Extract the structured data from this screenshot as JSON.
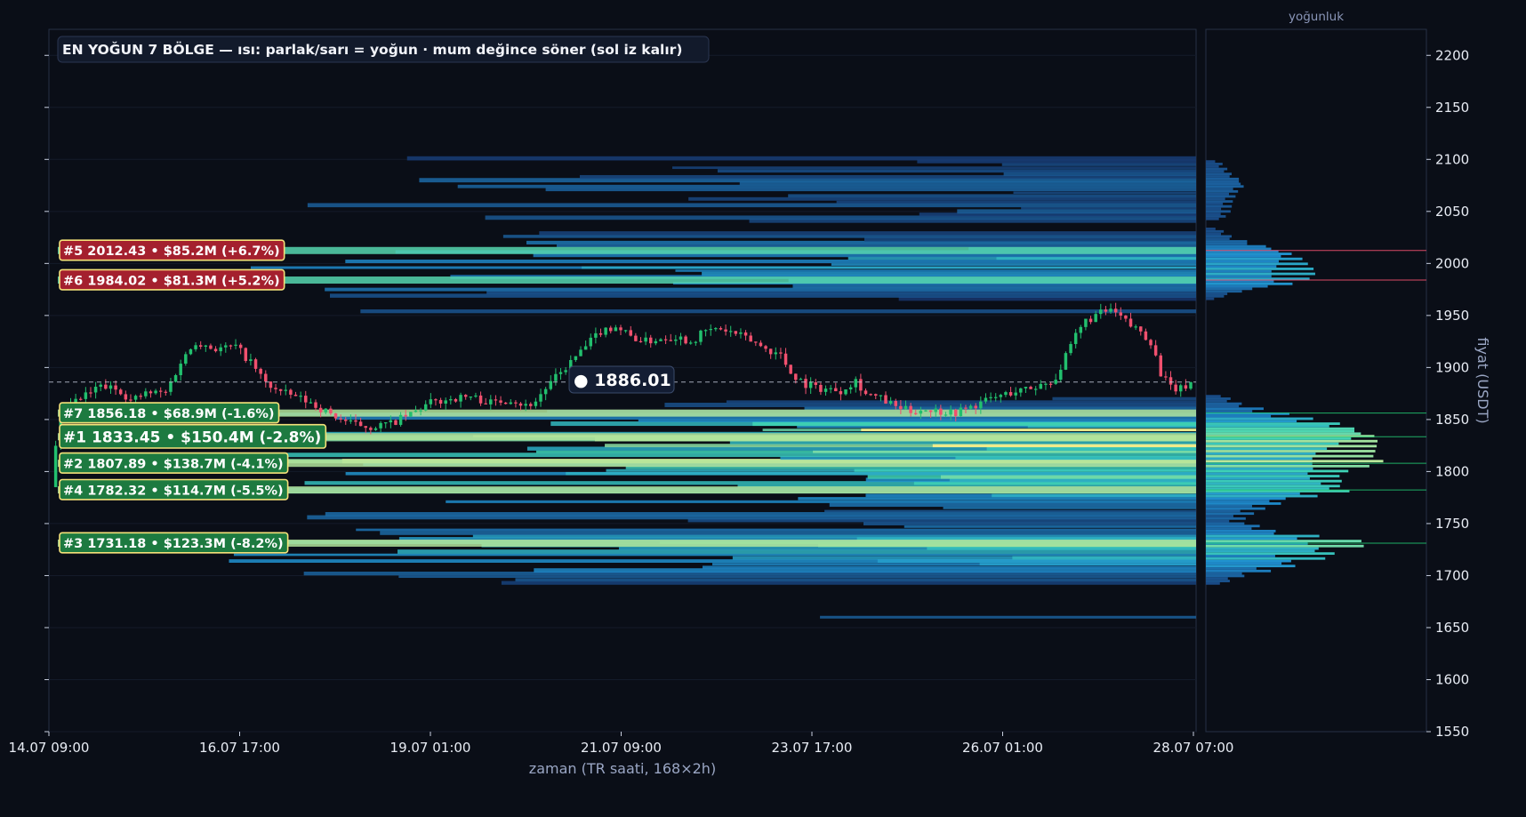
{
  "colors": {
    "background": "#0a0e17",
    "panel_border": "#263046",
    "bull": "#22c06e",
    "bear": "#f0506e",
    "heat_low": "#17326a",
    "heat_mid": "#1f8fd0",
    "heat_high": "#3fd3b4",
    "heat_peak": "#fdf08a",
    "label_bear_bg": "#a4202e",
    "label_bull_bg": "#1d7a40",
    "label_border": "#f5e27a",
    "text": "#e8ecf4",
    "muted": "#9aa6c4"
  },
  "title": "EN YOĞUN 7 BÖLGE — ısı: parlak/sarı = yoğun · mum değince söner (sol iz kalır)",
  "chart_data": {
    "type": "candlestick",
    "xlabel": "zaman (TR saati, 168×2h)",
    "ylabel": "fiyat (USDT)",
    "ylim": [
      1550,
      2225
    ],
    "x_ticks": [
      "14.07 09:00",
      "16.07 17:00",
      "19.07 01:00",
      "21.07 09:00",
      "23.07 17:00",
      "26.07 01:00",
      "28.07 07:00"
    ],
    "y_ticks": [
      1550,
      1600,
      1650,
      1700,
      1750,
      1800,
      1850,
      1900,
      1950,
      2000,
      2050,
      2100,
      2150,
      2200
    ],
    "current_price": 1886.01,
    "current_price_label": "● 1886.01",
    "close_path": [
      [
        0,
        1785
      ],
      [
        2,
        1858
      ],
      [
        6,
        1870
      ],
      [
        10,
        1882
      ],
      [
        14,
        1878
      ],
      [
        16,
        1868
      ],
      [
        19,
        1875
      ],
      [
        23,
        1876
      ],
      [
        26,
        1905
      ],
      [
        29,
        1925
      ],
      [
        33,
        1918
      ],
      [
        37,
        1920
      ],
      [
        40,
        1905
      ],
      [
        43,
        1885
      ],
      [
        46,
        1876
      ],
      [
        49,
        1872
      ],
      [
        52,
        1866
      ],
      [
        56,
        1855
      ],
      [
        60,
        1846
      ],
      [
        64,
        1843
      ],
      [
        68,
        1846
      ],
      [
        72,
        1855
      ],
      [
        76,
        1866
      ],
      [
        80,
        1870
      ],
      [
        84,
        1872
      ],
      [
        88,
        1866
      ],
      [
        92,
        1870
      ],
      [
        95,
        1863
      ],
      [
        97,
        1868
      ],
      [
        99,
        1880
      ],
      [
        102,
        1895
      ],
      [
        104,
        1905
      ],
      [
        107,
        1920
      ],
      [
        110,
        1935
      ],
      [
        113,
        1940
      ],
      [
        116,
        1930
      ],
      [
        119,
        1925
      ],
      [
        122,
        1928
      ],
      [
        125,
        1930
      ],
      [
        128,
        1925
      ],
      [
        131,
        1935
      ],
      [
        134,
        1937
      ],
      [
        137,
        1932
      ],
      [
        140,
        1926
      ],
      [
        143,
        1918
      ],
      [
        146,
        1912
      ],
      [
        148,
        1895
      ],
      [
        151,
        1884
      ],
      [
        154,
        1880
      ],
      [
        158,
        1878
      ],
      [
        161,
        1888
      ],
      [
        163,
        1875
      ],
      [
        166,
        1870
      ],
      [
        169,
        1862
      ],
      [
        172,
        1858
      ],
      [
        175,
        1860
      ],
      [
        178,
        1858
      ],
      [
        181,
        1857
      ],
      [
        184,
        1862
      ],
      [
        188,
        1870
      ],
      [
        192,
        1876
      ],
      [
        196,
        1880
      ],
      [
        199,
        1885
      ],
      [
        201,
        1890
      ],
      [
        203,
        1910
      ],
      [
        205,
        1930
      ],
      [
        207,
        1945
      ],
      [
        210,
        1952
      ],
      [
        212,
        1955
      ],
      [
        214,
        1948
      ],
      [
        216,
        1940
      ],
      [
        218,
        1935
      ],
      [
        220,
        1925
      ],
      [
        222,
        1895
      ],
      [
        224,
        1880
      ],
      [
        226,
        1879
      ],
      [
        228,
        1886
      ]
    ],
    "density_profile": [
      [
        1695,
        0.12
      ],
      [
        1700,
        0.2
      ],
      [
        1705,
        0.35
      ],
      [
        1710,
        0.5
      ],
      [
        1716,
        0.62
      ],
      [
        1722,
        0.72
      ],
      [
        1728,
        0.82
      ],
      [
        1733,
        0.78
      ],
      [
        1738,
        0.55
      ],
      [
        1743,
        0.35
      ],
      [
        1748,
        0.28
      ],
      [
        1755,
        0.2
      ],
      [
        1760,
        0.25
      ],
      [
        1765,
        0.32
      ],
      [
        1770,
        0.42
      ],
      [
        1776,
        0.58
      ],
      [
        1781,
        0.72
      ],
      [
        1785,
        0.78
      ],
      [
        1790,
        0.76
      ],
      [
        1795,
        0.72
      ],
      [
        1800,
        0.74
      ],
      [
        1805,
        0.82
      ],
      [
        1810,
        0.86
      ],
      [
        1815,
        0.84
      ],
      [
        1820,
        0.88
      ],
      [
        1825,
        0.92
      ],
      [
        1830,
        0.96
      ],
      [
        1835,
        0.98
      ],
      [
        1840,
        0.9
      ],
      [
        1845,
        0.78
      ],
      [
        1850,
        0.6
      ],
      [
        1855,
        0.45
      ],
      [
        1860,
        0.3
      ],
      [
        1865,
        0.18
      ],
      [
        1870,
        0.12
      ],
      [
        1970,
        0.12
      ],
      [
        1975,
        0.25
      ],
      [
        1980,
        0.45
      ],
      [
        1985,
        0.52
      ],
      [
        1990,
        0.53
      ],
      [
        1995,
        0.54
      ],
      [
        2000,
        0.53
      ],
      [
        2005,
        0.52
      ],
      [
        2010,
        0.48
      ],
      [
        2015,
        0.38
      ],
      [
        2020,
        0.25
      ],
      [
        2025,
        0.15
      ],
      [
        2030,
        0.1
      ],
      [
        2045,
        0.1
      ],
      [
        2050,
        0.12
      ],
      [
        2055,
        0.13
      ],
      [
        2060,
        0.14
      ],
      [
        2065,
        0.16
      ],
      [
        2070,
        0.18
      ],
      [
        2075,
        0.22
      ],
      [
        2080,
        0.2
      ],
      [
        2085,
        0.15
      ],
      [
        2090,
        0.12
      ],
      [
        2095,
        0.09
      ]
    ],
    "density_label": "yoğunluk",
    "zones": [
      {
        "rank": "#5",
        "price": 2012.43,
        "value": "$85.2M",
        "change": "(+6.7%)",
        "dir": "bear",
        "label": "#5  2012.43  •  $85.2M  (+6.7%)"
      },
      {
        "rank": "#6",
        "price": 1984.02,
        "value": "$81.3M",
        "change": "(+5.2%)",
        "dir": "bear",
        "label": "#6  1984.02  •  $81.3M  (+5.2%)"
      },
      {
        "rank": "#7",
        "price": 1856.18,
        "value": "$68.9M",
        "change": "(-1.6%)",
        "dir": "bull",
        "label": "#7  1856.18  •  $68.9M  (-1.6%)"
      },
      {
        "rank": "#1",
        "price": 1833.45,
        "value": "$150.4M",
        "change": "(-2.8%)",
        "dir": "bull",
        "label": "#1  1833.45  •  $150.4M  (-2.8%)"
      },
      {
        "rank": "#2",
        "price": 1807.89,
        "value": "$138.7M",
        "change": "(-4.1%)",
        "dir": "bull",
        "label": "#2  1807.89  •  $138.7M  (-4.1%)"
      },
      {
        "rank": "#4",
        "price": 1782.32,
        "value": "$114.7M",
        "change": "(-5.5%)",
        "dir": "bull",
        "label": "#4  1782.32  •  $114.7M  (-5.5%)"
      },
      {
        "rank": "#3",
        "price": 1731.18,
        "value": "$123.3M",
        "change": "(-8.2%)",
        "dir": "bull",
        "label": "#3  1731.18  •  $123.3M  (-8.2%)"
      }
    ]
  }
}
